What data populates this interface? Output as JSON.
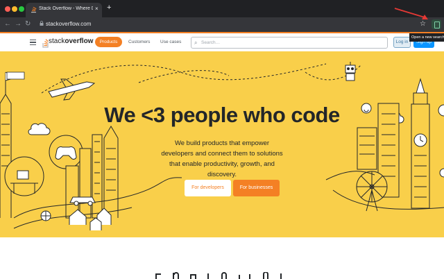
{
  "browser": {
    "tab": {
      "title": "Stack Overflow - Where Develop",
      "close_glyph": "×",
      "favicon_glyph": "⚡"
    },
    "new_tab_glyph": "+",
    "nav": {
      "back": "←",
      "forward": "→",
      "reload": "↻"
    },
    "url": "stackoverflow.com",
    "lock_glyph": "🔒",
    "star_glyph": "☆",
    "tooltip": "Open a new search"
  },
  "header": {
    "logo_plain": "stack",
    "logo_bold": "overflow",
    "nav": [
      "Products",
      "Customers",
      "Use cases"
    ],
    "search_placeholder": "Search…",
    "search_icon": "⌕",
    "login": "Log in",
    "signup": "Sign up"
  },
  "hero": {
    "title": "We <3 people who code",
    "subtitle": "We build products that empower developers and connect them to solutions that enable productivity, growth, and discovery.",
    "cta_developers": "For developers",
    "cta_businesses": "For businesses"
  },
  "colors": {
    "accent": "#f48024",
    "hero_bg": "#f9cf4a",
    "signup_blue": "#0a95ff",
    "annotation_red": "#e53935"
  },
  "icons": [
    "stack-overflow-favicon",
    "search-icon",
    "star-icon",
    "extension-icon",
    "hamburger-menu-icon",
    "red-arrow-annotation"
  ]
}
